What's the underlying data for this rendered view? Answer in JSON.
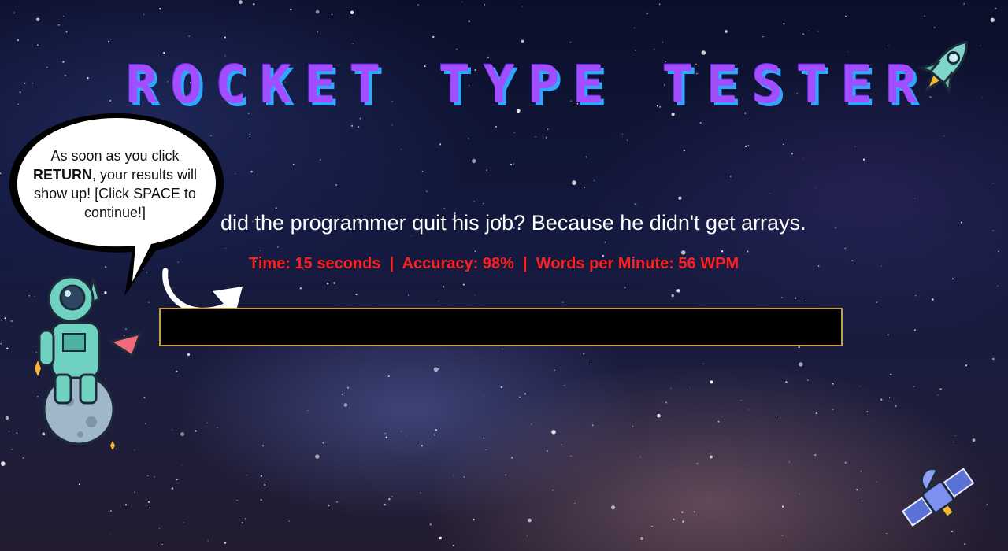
{
  "app": {
    "title": "Rocket Type Tester"
  },
  "hint_bubble": {
    "text_before": "As soon as you click ",
    "keyword": "RETURN",
    "text_after": ", your results will show up! [Click SPACE to continue!]"
  },
  "typing": {
    "prompt": "did the programmer quit his job? Because he didn't get arrays.",
    "input_value": "",
    "results": "Time: 15 seconds  |  Accuracy: 98%  |  Words per Minute: 56 WPM"
  },
  "icons": {
    "rocket": "rocket-icon",
    "astronaut": "astronaut-icon",
    "satellite": "satellite-icon",
    "arrow": "curved-arrow-icon",
    "bubble": "speech-bubble-icon"
  },
  "colors": {
    "title": "#a24dff",
    "title_shadow": "#2fa7ff",
    "results": "#ff1f1f",
    "input_border": "#c6a04a",
    "input_background": "#000000"
  }
}
